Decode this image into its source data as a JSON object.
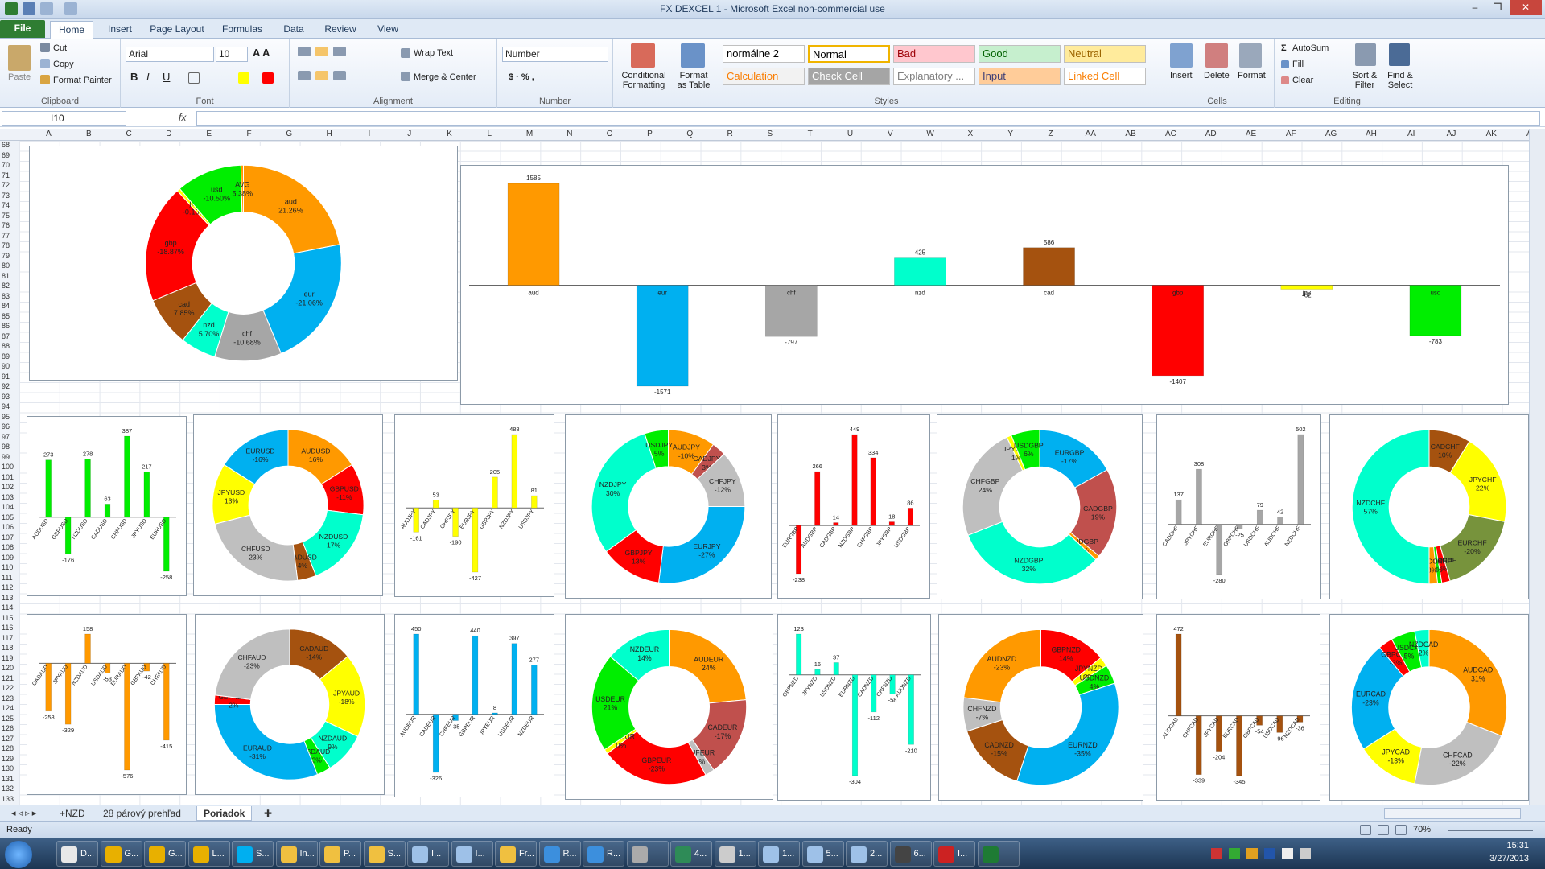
{
  "window": {
    "title": "FX DEXCEL 1 - Microsoft Excel non-commercial use"
  },
  "tabs": [
    "File",
    "Home",
    "Insert",
    "Page Layout",
    "Formulas",
    "Data",
    "Review",
    "View"
  ],
  "ribbon": {
    "clipboard": {
      "label": "Clipboard",
      "paste": "Paste",
      "cut": "Cut",
      "copy": "Copy",
      "format_painter": "Format Painter"
    },
    "font": {
      "label": "Font",
      "family": "Arial",
      "size": "10"
    },
    "alignment": {
      "label": "Alignment",
      "wrap": "Wrap Text",
      "merge": "Merge & Center"
    },
    "number": {
      "label": "Number",
      "format": "Number"
    },
    "styles": {
      "label": "Styles",
      "cond": "Conditional Formatting",
      "fmt_table": "Format as Table",
      "items": [
        {
          "label": "normálne 2",
          "bg": "#ffffff",
          "fg": "#000000"
        },
        {
          "label": "Normal",
          "bg": "#ffffff",
          "fg": "#000000"
        },
        {
          "label": "Bad",
          "bg": "#ffc7ce",
          "fg": "#9c0006"
        },
        {
          "label": "Good",
          "bg": "#c6efce",
          "fg": "#006100"
        },
        {
          "label": "Neutral",
          "bg": "#ffeb9c",
          "fg": "#9c6500"
        },
        {
          "label": "Calculation",
          "bg": "#f2f2f2",
          "fg": "#fa7d00"
        },
        {
          "label": "Check Cell",
          "bg": "#a5a5a5",
          "fg": "#ffffff"
        },
        {
          "label": "Explanatory ...",
          "bg": "#ffffff",
          "fg": "#7f7f7f"
        },
        {
          "label": "Input",
          "bg": "#ffcc99",
          "fg": "#3f3f76"
        },
        {
          "label": "Linked Cell",
          "bg": "#ffffff",
          "fg": "#fa7d00"
        }
      ]
    },
    "cells": {
      "label": "Cells",
      "insert": "Insert",
      "delete": "Delete",
      "format": "Format"
    },
    "editing": {
      "label": "Editing",
      "autosum": "AutoSum",
      "fill": "Fill",
      "clear": "Clear",
      "sort": "Sort & Filter",
      "find": "Find & Select"
    }
  },
  "formula_bar": {
    "name_box": "I10",
    "fx": "fx",
    "formula": ""
  },
  "columns": [
    "A",
    "B",
    "C",
    "D",
    "E",
    "F",
    "G",
    "H",
    "I",
    "J",
    "K",
    "L",
    "M",
    "N",
    "O",
    "P",
    "Q",
    "R",
    "S",
    "T",
    "U",
    "V",
    "W",
    "X",
    "Y",
    "Z",
    "AA",
    "AB",
    "AC",
    "AD",
    "AE",
    "AF",
    "AG",
    "AH",
    "AI",
    "AJ",
    "AK",
    "AL",
    "AM"
  ],
  "rows_start": 68,
  "rows_end": 136,
  "colors": {
    "aud": "#ff9900",
    "eur": "#00b0f0",
    "chf": "#a6a6a6",
    "nzd": "#00ffcc",
    "cad": "#a5520f",
    "gbp": "#ff0000",
    "jpy": "#ffff00",
    "usd": "#00ee00",
    "darkred": "#c0504d",
    "gray2": "#bfbfbf",
    "olive": "#77933c"
  },
  "chart_data": [
    {
      "type": "pie",
      "donut": true,
      "slices": [
        {
          "label": "aud",
          "pct": "21.26%",
          "value": 21.26,
          "color": "aud"
        },
        {
          "label": "eur",
          "pct": "-21.06%",
          "value": 21.06,
          "color": "eur"
        },
        {
          "label": "chf",
          "pct": "-10.68%",
          "value": 10.68,
          "color": "chf"
        },
        {
          "label": "nzd",
          "pct": "5.70%",
          "value": 5.7,
          "color": "nzd"
        },
        {
          "label": "cad",
          "pct": "7.85%",
          "value": 7.85,
          "color": "cad"
        },
        {
          "label": "gbp",
          "pct": "-18.87%",
          "value": 18.87,
          "color": "gbp"
        },
        {
          "label": "jpy",
          "pct": "-0.10%",
          "value": 0.5,
          "color": "jpy"
        },
        {
          "label": "usd",
          "pct": "-10.50%",
          "value": 10.5,
          "color": "usd"
        },
        {
          "label": "AVG",
          "pct": "5.38%",
          "value": 0.4,
          "color": "aud"
        }
      ]
    },
    {
      "type": "bar",
      "categories": [
        "aud",
        "eur",
        "chf",
        "nzd",
        "cad",
        "gbp",
        "jpy",
        "usd"
      ],
      "values": [
        1585,
        -1571,
        -797,
        425,
        586,
        -1407,
        -62,
        -783
      ],
      "colors": [
        "aud",
        "eur",
        "chf",
        "nzd",
        "cad",
        "gbp",
        "jpy",
        "usd"
      ]
    },
    {
      "type": "bar",
      "color": "usd",
      "categories": [
        "AUDUSD",
        "GBPUSD",
        "NZDUSD",
        "CADUSD",
        "CHFUSD",
        "JPYUSD",
        "EURUSD"
      ],
      "values": [
        273,
        -176,
        278,
        63,
        387,
        217,
        -258
      ]
    },
    {
      "type": "pie",
      "donut": true,
      "slices": [
        {
          "label": "AUDUSD",
          "pct": "16%",
          "value": 16,
          "color": "aud"
        },
        {
          "label": "GBPUSD",
          "pct": "-11%",
          "value": 11,
          "color": "gbp"
        },
        {
          "label": "NZDUSD",
          "pct": "17%",
          "value": 17,
          "color": "nzd"
        },
        {
          "label": "CADUSD",
          "pct": "4%",
          "value": 4,
          "color": "cad"
        },
        {
          "label": "CHFUSD",
          "pct": "23%",
          "value": 23,
          "color": "gray2"
        },
        {
          "label": "JPYUSD",
          "pct": "13%",
          "value": 13,
          "color": "jpy"
        },
        {
          "label": "EURUSD",
          "pct": "-16%",
          "value": 16,
          "color": "eur"
        }
      ]
    },
    {
      "type": "bar",
      "color": "jpy",
      "categories": [
        "AUDJPY",
        "CADJPY",
        "CHFJPY",
        "EURJPY",
        "GBPJPY",
        "NZDJPY",
        "USDJPY"
      ],
      "values": [
        -161,
        53,
        -190,
        -427,
        205,
        488,
        81
      ]
    },
    {
      "type": "pie",
      "donut": true,
      "slices": [
        {
          "label": "AUDJPY",
          "pct": "-10%",
          "value": 10,
          "color": "aud"
        },
        {
          "label": "CADJPY",
          "pct": "3%",
          "value": 3,
          "color": "darkred"
        },
        {
          "label": "CHFJPY",
          "pct": "-12%",
          "value": 12,
          "color": "gray2"
        },
        {
          "label": "EURJPY",
          "pct": "-27%",
          "value": 27,
          "color": "eur"
        },
        {
          "label": "GBPJPY",
          "pct": "13%",
          "value": 13,
          "color": "gbp"
        },
        {
          "label": "NZDJPY",
          "pct": "30%",
          "value": 30,
          "color": "nzd"
        },
        {
          "label": "USDJPY",
          "pct": "5%",
          "value": 5,
          "color": "usd"
        }
      ]
    },
    {
      "type": "bar",
      "color": "gbp",
      "categories": [
        "EURGBP",
        "AUDGBP",
        "CADGBP",
        "NZDGBP",
        "CHFGBP",
        "JPYGBP",
        "USDGBP"
      ],
      "values": [
        -238,
        266,
        14,
        449,
        334,
        18,
        86
      ]
    },
    {
      "type": "pie",
      "donut": true,
      "slices": [
        {
          "label": "EURGBP",
          "pct": "-17%",
          "value": 17,
          "color": "eur"
        },
        {
          "label": "CADGBP",
          "pct": "19%",
          "value": 19,
          "color": "darkred"
        },
        {
          "label": "AUDGBP",
          "pct": "1%",
          "value": 1,
          "color": "aud"
        },
        {
          "label": "NZDGBP",
          "pct": "32%",
          "value": 32,
          "color": "nzd"
        },
        {
          "label": "CHFGBP",
          "pct": "24%",
          "value": 24,
          "color": "gray2"
        },
        {
          "label": "JPYGBP",
          "pct": "1%",
          "value": 1,
          "color": "jpy"
        },
        {
          "label": "USDGBP",
          "pct": "6%",
          "value": 6,
          "color": "usd"
        }
      ]
    },
    {
      "type": "bar",
      "color": "chf",
      "categories": [
        "CADCHF",
        "JPYCHF",
        "EURCHF",
        "GBPCHF",
        "USDCHF",
        "AUDCHF",
        "NZDCHF"
      ],
      "values": [
        137,
        308,
        -280,
        -25,
        79,
        42,
        502
      ]
    },
    {
      "type": "pie",
      "donut": true,
      "slices": [
        {
          "label": "CADCHF",
          "pct": "10%",
          "value": 10,
          "color": "cad"
        },
        {
          "label": "JPYCHF",
          "pct": "22%",
          "value": 22,
          "color": "jpy"
        },
        {
          "label": "EURCHF",
          "pct": "-20%",
          "value": 20,
          "color": "olive"
        },
        {
          "label": "GBPCHF",
          "pct": "2%",
          "value": 2,
          "color": "gbp"
        },
        {
          "label": "USDCHF",
          "pct": "6%",
          "value": 1,
          "color": "usd"
        },
        {
          "label": "AUDCHF",
          "pct": "3%",
          "value": 2,
          "color": "aud"
        },
        {
          "label": "NZDCHF",
          "pct": "57%",
          "value": 57,
          "color": "nzd"
        }
      ]
    },
    {
      "type": "bar",
      "color": "aud",
      "categories": [
        "CADAUD",
        "JPYAUD",
        "NZDAUD",
        "USDAUD",
        "EURAUD",
        "GBPAUD",
        "CHFAUD"
      ],
      "values": [
        -258,
        -329,
        158,
        -53,
        -576,
        -42,
        -415
      ]
    },
    {
      "type": "pie",
      "donut": true,
      "slices": [
        {
          "label": "CADAUD",
          "pct": "-14%",
          "value": 14,
          "color": "cad"
        },
        {
          "label": "JPYAUD",
          "pct": "-18%",
          "value": 18,
          "color": "jpy"
        },
        {
          "label": "NZDAUD",
          "pct": "9%",
          "value": 9,
          "color": "nzd"
        },
        {
          "label": "USDAUD",
          "pct": "-3%",
          "value": 3,
          "color": "usd"
        },
        {
          "label": "EURAUD",
          "pct": "-31%",
          "value": 31,
          "color": "eur"
        },
        {
          "label": "GBPAUD",
          "pct": "-2%",
          "value": 2,
          "color": "gbp"
        },
        {
          "label": "CHFAUD",
          "pct": "-23%",
          "value": 23,
          "color": "gray2"
        }
      ]
    },
    {
      "type": "bar",
      "color": "eur",
      "categories": [
        "AUDEUR",
        "CADEUR",
        "CHFEUR",
        "GBPEUR",
        "JPYEUR",
        "USDEUR",
        "NZDEUR"
      ],
      "values": [
        450,
        -326,
        -35,
        440,
        8,
        397,
        277
      ]
    },
    {
      "type": "pie",
      "donut": true,
      "slices": [
        {
          "label": "AUDEUR",
          "pct": "24%",
          "value": 24,
          "color": "aud"
        },
        {
          "label": "CADEUR",
          "pct": "-17%",
          "value": 17,
          "color": "darkred"
        },
        {
          "label": "CHFEUR",
          "pct": "2%",
          "value": 2,
          "color": "gray2"
        },
        {
          "label": "GBPEUR",
          "pct": "-23%",
          "value": 23,
          "color": "gbp"
        },
        {
          "label": "JPYEUR",
          "pct": "0%",
          "value": 1,
          "color": "jpy"
        },
        {
          "label": "USDEUR",
          "pct": "21%",
          "value": 21,
          "color": "usd"
        },
        {
          "label": "NZDEUR",
          "pct": "14%",
          "value": 14,
          "color": "nzd"
        }
      ]
    },
    {
      "type": "bar",
      "color": "nzd",
      "categories": [
        "GBPNZD",
        "JPYNZD",
        "USDNZD",
        "EURNZD",
        "CADNZD",
        "CHFNZD",
        "AUDNZD"
      ],
      "values": [
        123,
        16,
        37,
        -304,
        -112,
        -58,
        -210
      ]
    },
    {
      "type": "pie",
      "donut": true,
      "slices": [
        {
          "label": "GBPNZD",
          "pct": "14%",
          "value": 14,
          "color": "gbp"
        },
        {
          "label": "JPYNZD",
          "pct": "2%",
          "value": 2,
          "color": "jpy"
        },
        {
          "label": "USDNZD",
          "pct": "4%",
          "value": 4,
          "color": "usd"
        },
        {
          "label": "EURNZD",
          "pct": "-35%",
          "value": 35,
          "color": "eur"
        },
        {
          "label": "CADNZD",
          "pct": "-15%",
          "value": 15,
          "color": "cad"
        },
        {
          "label": "CHFNZD",
          "pct": "-7%",
          "value": 7,
          "color": "gray2"
        },
        {
          "label": "AUDNZD",
          "pct": "-23%",
          "value": 23,
          "color": "aud"
        }
      ]
    },
    {
      "type": "bar",
      "color": "cad",
      "categories": [
        "AUDCAD",
        "CHFCAD",
        "JPYCAD",
        "EURCAD",
        "GBPCAD",
        "USDCAD",
        "NZDCAD"
      ],
      "values": [
        472,
        -339,
        -204,
        -345,
        -54,
        -96,
        -36
      ]
    },
    {
      "type": "pie",
      "donut": true,
      "slices": [
        {
          "label": "AUDCAD",
          "pct": "31%",
          "value": 31,
          "color": "aud"
        },
        {
          "label": "CHFCAD",
          "pct": "-22%",
          "value": 22,
          "color": "gray2"
        },
        {
          "label": "JPYCAD",
          "pct": "-13%",
          "value": 13,
          "color": "jpy"
        },
        {
          "label": "EURCAD",
          "pct": "-23%",
          "value": 23,
          "color": "eur"
        },
        {
          "label": "GBPCAD",
          "pct": "-3%",
          "value": 3,
          "color": "gbp"
        },
        {
          "label": "USDCAD",
          "pct": "5%",
          "value": 5,
          "color": "usd"
        },
        {
          "label": "NZDCAD",
          "pct": "2%",
          "value": 3,
          "color": "nzd"
        }
      ]
    }
  ],
  "sheet_tabs": [
    "+NZD",
    "28 párový prehľad",
    "Poriadok"
  ],
  "active_sheet": "Poriadok",
  "status": {
    "ready": "Ready",
    "zoom": "70%"
  },
  "taskbar": {
    "apps": [
      {
        "label": "D...",
        "color": "#e8e8e8"
      },
      {
        "label": "G...",
        "color": "#e8b000"
      },
      {
        "label": "G...",
        "color": "#e8b000"
      },
      {
        "label": "L...",
        "color": "#e8b000"
      },
      {
        "label": "S...",
        "color": "#00aff0"
      },
      {
        "label": "In...",
        "color": "#f0c040"
      },
      {
        "label": "P...",
        "color": "#f0c040"
      },
      {
        "label": "S...",
        "color": "#f0c040"
      },
      {
        "label": "I...",
        "color": "#9ec1e8"
      },
      {
        "label": "I...",
        "color": "#9ec1e8"
      },
      {
        "label": "Fr...",
        "color": "#f0c040"
      },
      {
        "label": "R...",
        "color": "#3c8fdd"
      },
      {
        "label": "R...",
        "color": "#3c8fdd"
      },
      {
        "label": "",
        "color": "#aaaaaa"
      },
      {
        "label": "4...",
        "color": "#2e8b57"
      },
      {
        "label": "1...",
        "color": "#cccccc"
      },
      {
        "label": "1...",
        "color": "#9ec1e8"
      },
      {
        "label": "5...",
        "color": "#9ec1e8"
      },
      {
        "label": "2...",
        "color": "#9ec1e8"
      },
      {
        "label": "6...",
        "color": "#444444"
      },
      {
        "label": "I...",
        "color": "#cc2222"
      },
      {
        "label": "",
        "color": "#1e7b34"
      }
    ],
    "time": "15:31",
    "date": "3/27/2013"
  }
}
